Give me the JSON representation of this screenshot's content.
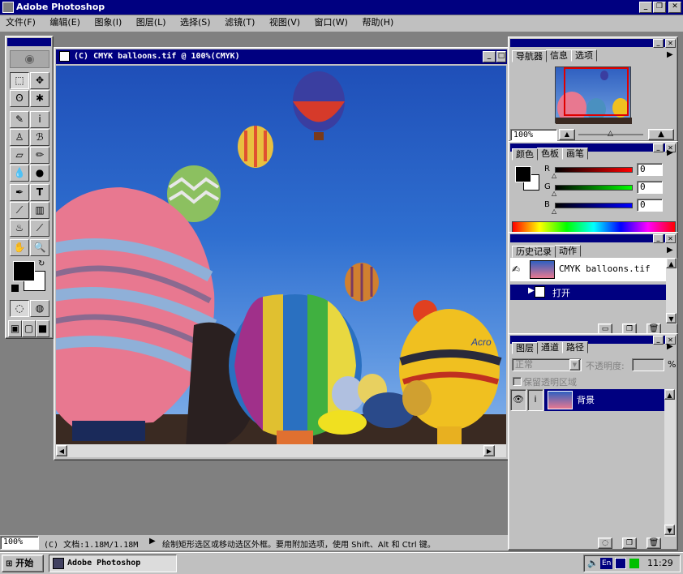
{
  "app": {
    "title": "Adobe Photoshop"
  },
  "menu": [
    "文件(F)",
    "编辑(E)",
    "图象(I)",
    "图层(L)",
    "选择(S)",
    "滤镜(T)",
    "视图(V)",
    "窗口(W)",
    "帮助(H)"
  ],
  "doc": {
    "title": "(C) CMYK balloons.tif @ 100%(CMYK)"
  },
  "navigator": {
    "tabs": [
      "导航器",
      "信息",
      "选项"
    ],
    "zoom": "100%"
  },
  "color": {
    "tabs": [
      "颜色",
      "色板",
      "画笔"
    ],
    "channels": [
      {
        "label": "R",
        "value": "0"
      },
      {
        "label": "G",
        "value": "0"
      },
      {
        "label": "B",
        "value": "0"
      }
    ]
  },
  "history": {
    "tabs": [
      "历史记录",
      "动作"
    ],
    "snapshot": "CMYK balloons.tif",
    "step": "打开"
  },
  "layers": {
    "tabs": [
      "图层",
      "通道",
      "路径"
    ],
    "mode": "正常",
    "opacity_label": "不透明度:",
    "opacity_pct": "%",
    "preserve": "保留透明区域",
    "layer_name": "背景"
  },
  "status": {
    "zoom": "100%",
    "doc": "(C) 文档:1.18M/1.18M",
    "hint": "绘制矩形选区或移动选区外框。要用附加选项，使用 Shift、Alt 和 Ctrl 键。"
  },
  "taskbar": {
    "start": "开始",
    "task": "Adobe Photoshop",
    "lang": "En",
    "time": "11:29"
  },
  "colors": {
    "title_bar": "#000080",
    "face": "#c0c0c0",
    "desktop": "#808080",
    "sky": "#2f6fd0"
  }
}
